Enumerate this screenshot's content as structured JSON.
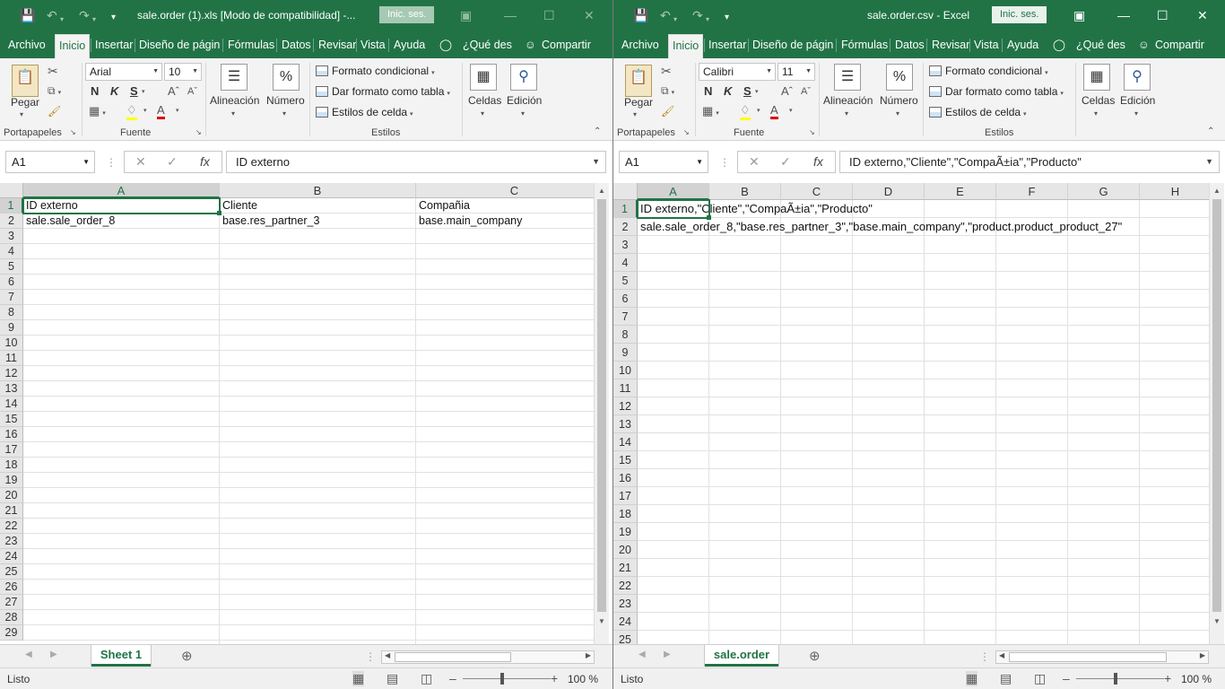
{
  "left": {
    "title": "sale.order (1).xls  [Modo de compatibilidad]  -...",
    "signin": "Inic. ses.",
    "tabs": [
      "Archivo",
      "Inicio",
      "Insertar",
      "Diseño de página",
      "Fórmulas",
      "Datos",
      "Revisar",
      "Vista",
      "Ayuda"
    ],
    "tell_me": "¿Qué des",
    "share": "Compartir",
    "ribbon": {
      "paste": "Pegar",
      "font_name": "Arial",
      "font_size": "10",
      "bold": "N",
      "italic": "K",
      "underline": "S",
      "alignment": "Alineación",
      "number": "Número",
      "cond_format": "Formato condicional",
      "format_table": "Dar formato como tabla",
      "cell_styles": "Estilos de celda",
      "cells": "Celdas",
      "editing": "Edición",
      "groups": {
        "clipboard": "Portapapeles",
        "font": "Fuente",
        "styles": "Estilos"
      }
    },
    "name_box": "A1",
    "formula": "ID externo",
    "columns": [
      "A",
      "B",
      "C"
    ],
    "rows": [
      "1",
      "2",
      "3",
      "4",
      "5",
      "6",
      "7",
      "8",
      "9",
      "10",
      "11",
      "12",
      "13",
      "14",
      "15",
      "16",
      "17",
      "18",
      "19",
      "20",
      "21",
      "22",
      "23",
      "24",
      "25",
      "26",
      "27",
      "28",
      "29"
    ],
    "cells": {
      "A1": "ID externo",
      "B1": "Cliente",
      "C1": "Compañia",
      "A2": "sale.sale_order_8",
      "B2": "base.res_partner_3",
      "C2": "base.main_company"
    },
    "sheet_tab": "Sheet 1",
    "status": "Listo",
    "zoom": "100 %"
  },
  "right": {
    "title": "sale.order.csv  -  Excel",
    "signin": "Inic. ses.",
    "tabs": [
      "Archivo",
      "Inicio",
      "Insertar",
      "Diseño de página",
      "Fórmulas",
      "Datos",
      "Revisar",
      "Vista",
      "Ayuda"
    ],
    "tell_me": "¿Qué des",
    "share": "Compartir",
    "ribbon": {
      "paste": "Pegar",
      "font_name": "Calibri",
      "font_size": "11",
      "bold": "N",
      "italic": "K",
      "underline": "S",
      "alignment": "Alineación",
      "number": "Número",
      "cond_format": "Formato condicional",
      "format_table": "Dar formato como tabla",
      "cell_styles": "Estilos de celda",
      "cells": "Celdas",
      "editing": "Edición",
      "groups": {
        "clipboard": "Portapapeles",
        "font": "Fuente",
        "styles": "Estilos"
      }
    },
    "name_box": "A1",
    "formula": "ID externo,\"Cliente\",\"CompaÃ±ia\",\"Producto\"",
    "columns": [
      "A",
      "B",
      "C",
      "D",
      "E",
      "F",
      "G",
      "H"
    ],
    "rows": [
      "1",
      "2",
      "3",
      "4",
      "5",
      "6",
      "7",
      "8",
      "9",
      "10",
      "11",
      "12",
      "13",
      "14",
      "15",
      "16",
      "17",
      "18",
      "19",
      "20",
      "21",
      "22",
      "23",
      "24",
      "25"
    ],
    "cells": {
      "A1": "ID externo,\"Cliente\",\"CompaÃ±ia\",\"Producto\"",
      "A2": "sale.sale_order_8,\"base.res_partner_3\",\"base.main_company\",\"product.product_product_27\""
    },
    "sheet_tab": "sale.order",
    "status": "Listo",
    "zoom": "100 %"
  },
  "icons": {
    "save": "save-icon",
    "undo": "undo-icon",
    "redo": "redo-icon",
    "customize": "qat-customize-icon",
    "ribbon_options": "ribbon-display-icon",
    "minimize": "minimize-icon",
    "maximize": "maximize-icon",
    "close": "close-icon"
  },
  "colors": {
    "accent": "#217346",
    "ribbon_bg": "#f3f3f3"
  }
}
